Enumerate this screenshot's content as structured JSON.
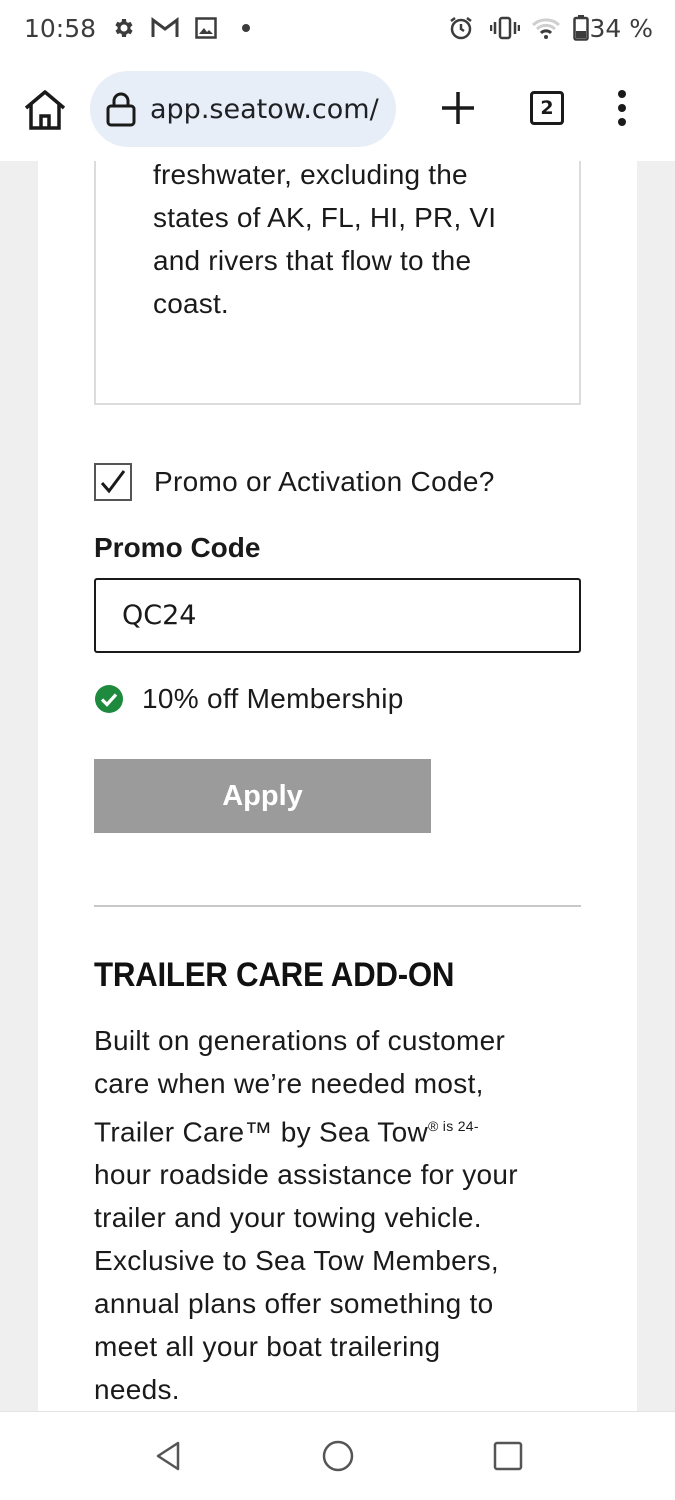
{
  "status_bar": {
    "time": "10:58",
    "battery_text": "34 %",
    "icons": [
      "settings-icon",
      "gmail-icon",
      "image-icon",
      "dot-icon",
      "alarm-icon",
      "vibrate-icon",
      "wifi-icon",
      "battery-icon"
    ]
  },
  "browser": {
    "url": "app.seatow.com/",
    "tab_count": "2",
    "icons": [
      "home-icon",
      "lock-icon",
      "plus-icon",
      "tabs-icon",
      "more-vert-icon"
    ]
  },
  "plan_box": {
    "lines": [
      "freshwater, excluding the",
      "states of AK, FL, HI, PR, VI",
      "and rivers that flow to the",
      "coast."
    ]
  },
  "promo": {
    "checkbox_label": "Promo or Activation Code?",
    "checked": true,
    "field_label": "Promo Code",
    "field_value": "QC24",
    "status_text": "10% off Membership",
    "apply_label": "Apply"
  },
  "addon": {
    "heading": "TRAILER CARE ADD-ON",
    "body_lines": [
      "Built on generations of customer",
      "care when we’re needed most,",
      "Trailer Care™  by Sea Tow",
      "® is 24-",
      "hour roadside assistance for your",
      "trailer and your towing vehicle.",
      "Exclusive to Sea Tow Members,",
      "annual plans offer something to",
      "meet all your boat trailering",
      "needs."
    ]
  },
  "colors": {
    "url_pill_bg": "#e8eef7",
    "apply_disabled_bg": "#9b9b9b",
    "success_green": "#1e8a3e",
    "page_gutter": "#efefef"
  },
  "nav_bar": {
    "icons": [
      "back-icon",
      "home-circle-icon",
      "recents-icon"
    ]
  }
}
